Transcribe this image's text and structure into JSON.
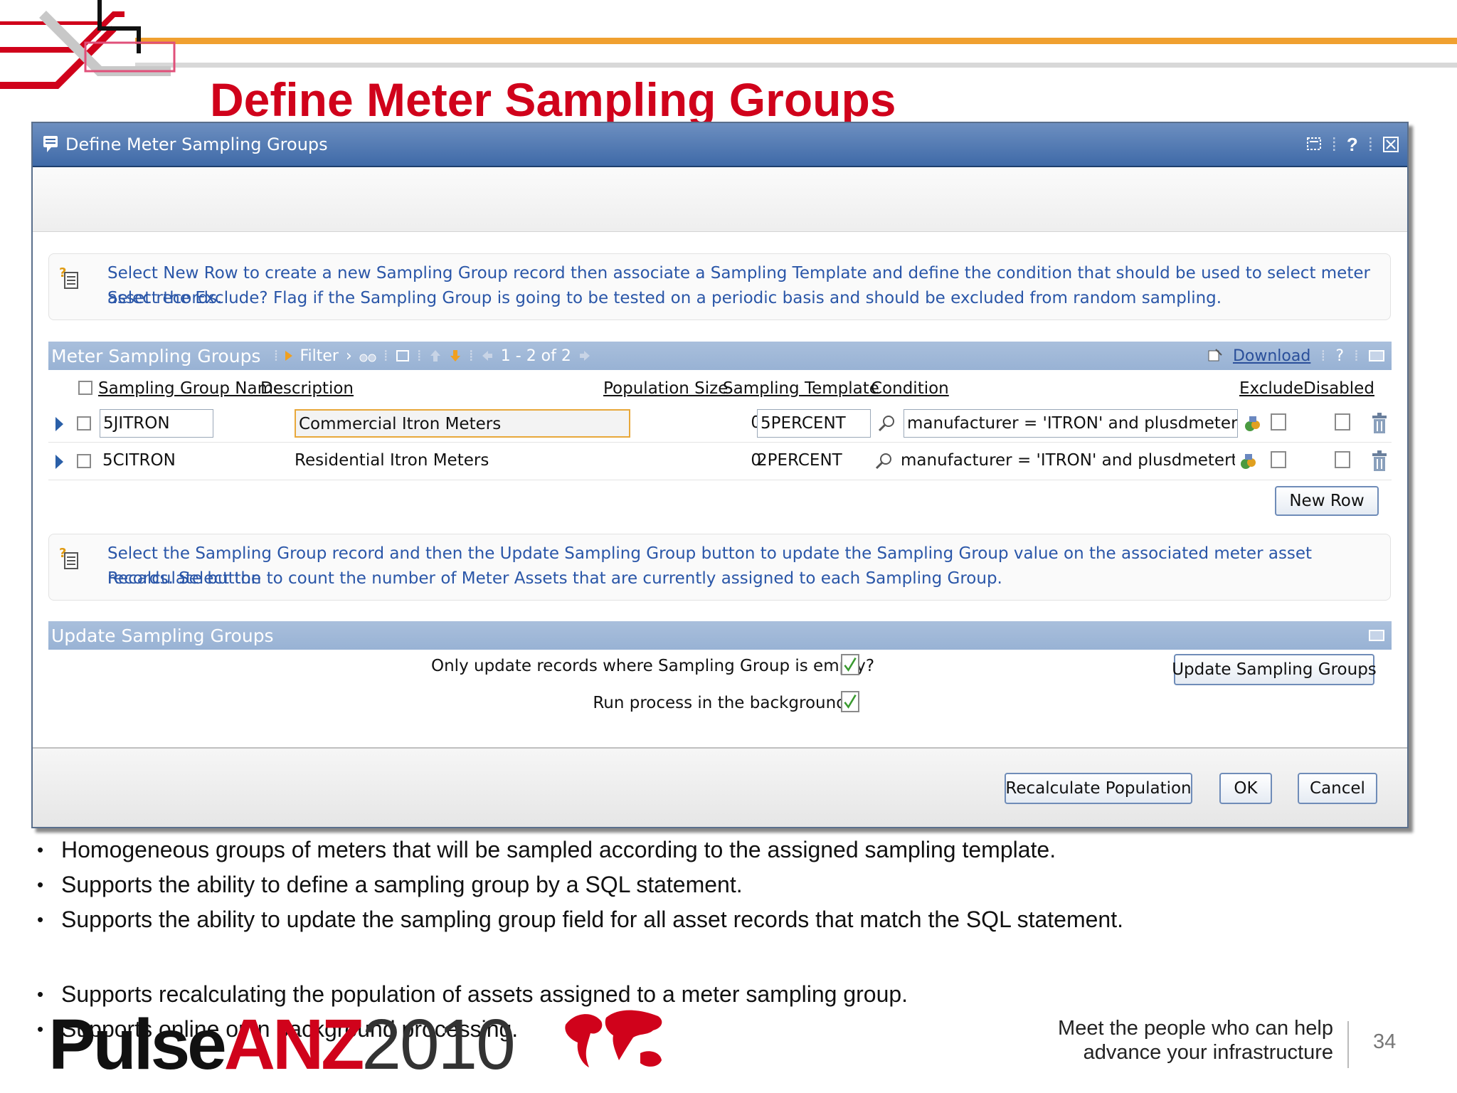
{
  "slide": {
    "title": "Define Meter Sampling Groups",
    "page_number": "34",
    "bullets": [
      "Homogeneous groups of meters that will be sampled according to the assigned sampling template.",
      "Supports the ability to define a sampling group by a SQL statement.",
      "Supports the ability to update the sampling group field for all asset records that match the SQL statement.",
      "Supports recalculating the population of assets assigned to a meter sampling group.",
      "Supports online or in background processing."
    ],
    "brand": {
      "pulse": "Pulse",
      "anz": "ANZ",
      "year": "2010"
    },
    "tagline_line1": "Meet the people who can help",
    "tagline_line2": "advance your infrastructure",
    "colors": {
      "brand_red": "#d0021b",
      "deco_orange": "#f0a030",
      "window_blue": "#4a74b0"
    }
  },
  "window": {
    "title": "Define Meter Sampling Groups",
    "title_icon": "dialog-icon",
    "controls": {
      "help": "?",
      "bookmark_icon": "bookmark-icon",
      "close_icon": "close-icon"
    }
  },
  "hint1": {
    "line1": "Select New Row to create a new Sampling Group record then associate a Sampling Template and define the condition that should be used to select meter asset records.",
    "line2": "Select the Exclude? Flag if the Sampling Group is going to be tested on a periodic basis and should be excluded from random sampling."
  },
  "table": {
    "title": "Meter Sampling Groups",
    "filter_label": "Filter",
    "pagination": "1 - 2 of 2",
    "download_label": "Download",
    "help": "?",
    "columns": {
      "name": "Sampling Group Name",
      "description": "Description",
      "population": "Population Size",
      "template": "Sampling Template",
      "condition": "Condition",
      "exclude": "Exclude",
      "disabled": "Disabled"
    },
    "rows": [
      {
        "name": "5JITRON",
        "description": "Commercial Itron Meters",
        "population": "0",
        "template": "5PERCENT",
        "condition": "manufacturer = 'ITRON' and plusdmetertype = '",
        "exclude": false,
        "disabled": false
      },
      {
        "name": "5CITRON",
        "description": "Residential Itron Meters",
        "population": "0",
        "template": "2PERCENT",
        "condition": "manufacturer = 'ITRON' and plusdmetertype = '",
        "exclude": false,
        "disabled": false
      }
    ],
    "new_row_label": "New Row"
  },
  "hint2": {
    "line1": "Select the Sampling Group record and then the Update Sampling Group button to update the Sampling Group value on the associated meter asset records. Select the",
    "line2": "Recalculate button to count the number of Meter Assets that are currently assigned to each Sampling Group."
  },
  "update_section": {
    "title": "Update Sampling Groups",
    "option1_label": "Only update records where Sampling Group is empty?",
    "option1_checked": true,
    "option2_label": "Run process in the background?",
    "option2_checked": true,
    "update_button": "Update Sampling Groups"
  },
  "footer": {
    "recalculate": "Recalculate Population",
    "ok": "OK",
    "cancel": "Cancel"
  }
}
